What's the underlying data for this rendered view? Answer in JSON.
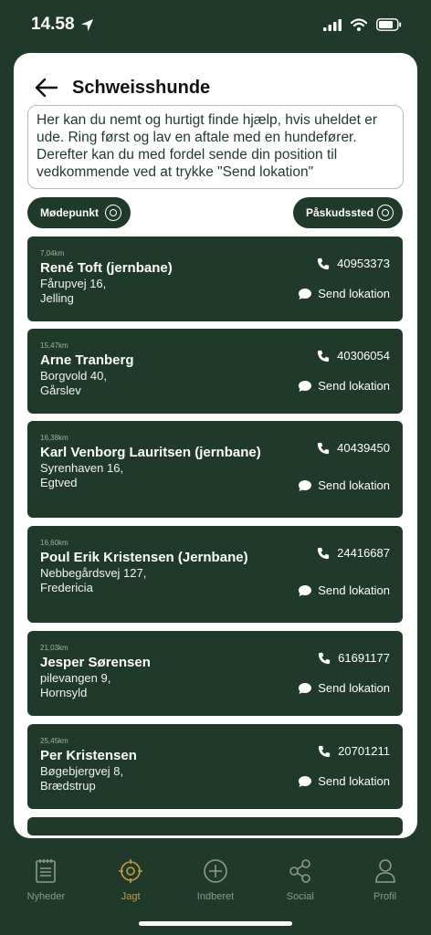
{
  "status": {
    "time": "14.58"
  },
  "header": {
    "title": "Schweisshunde"
  },
  "info_text": "Her kan du nemt og hurtigt finde hjælp, hvis uheldet er ude. Ring først og lav en aftale med en hundefører. Derefter kan du med fordel sende din position til vedkommende ved at trykke \"Send lokation\"",
  "filters": {
    "left_label": "Mødepunkt",
    "right_label": "Påskudssted"
  },
  "send_label": "Send lokation",
  "contacts": [
    {
      "distance": "7,04km",
      "name": "René Toft (jernbane)",
      "street": "Fårupvej 16,",
      "city": "Jelling",
      "phone": "40953373"
    },
    {
      "distance": "15,47km",
      "name": "Arne Tranberg",
      "street": "Borgvold 40,",
      "city": "Gårslev",
      "phone": "40306054"
    },
    {
      "distance": "16,38km",
      "name": "Karl Venborg Lauritsen (jernbane)",
      "street": "Syrenhaven 16,",
      "city": "Egtved",
      "phone": "40439450"
    },
    {
      "distance": "16,60km",
      "name": "Poul Erik Kristensen (Jernbane)",
      "street": "Nebbegårdsvej 127,",
      "city": "Fredericia",
      "phone": "24416687"
    },
    {
      "distance": "21,03km",
      "name": "Jesper Sørensen",
      "street": "pilevangen 9,",
      "city": "Hornsyld",
      "phone": "61691177"
    },
    {
      "distance": "25,45km",
      "name": "Per Kristensen",
      "street": "Bøgebjergvej 8,",
      "city": "Brædstrup",
      "phone": "20701211"
    }
  ],
  "tabs": [
    {
      "label": "Nyheder",
      "icon": "news-icon"
    },
    {
      "label": "Jagt",
      "icon": "target-icon",
      "active": true
    },
    {
      "label": "Indberet",
      "icon": "plus-circle-icon"
    },
    {
      "label": "Social",
      "icon": "share-icon"
    },
    {
      "label": "Profil",
      "icon": "person-icon"
    }
  ],
  "colors": {
    "brand_green": "#1f3a2b",
    "active_tab": "#c89a3e",
    "inactive_tab": "#8a9a8f"
  }
}
